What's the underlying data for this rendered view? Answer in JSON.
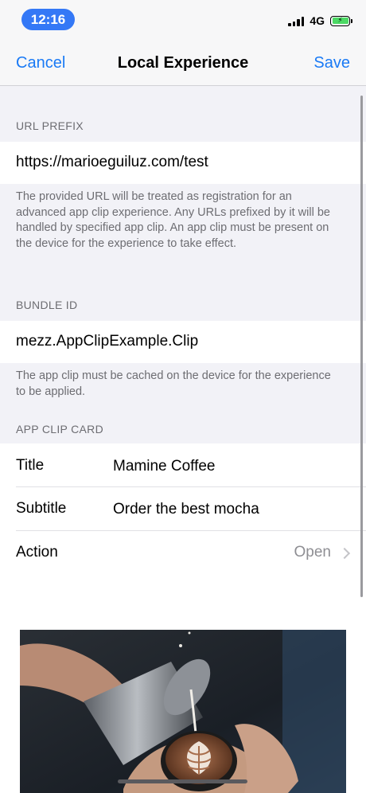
{
  "status_bar": {
    "time": "12:16",
    "network": "4G"
  },
  "nav": {
    "cancel_label": "Cancel",
    "title": "Local Experience",
    "save_label": "Save"
  },
  "url_section": {
    "header": "URL PREFIX",
    "value": "https://marioeguiluz.com/test",
    "footer": "The provided URL will be treated as registration for an advanced app clip experience. Any URLs prefixed by it will be handled by specified app clip. An app clip must be present on the device for the experience to take effect."
  },
  "bundle_section": {
    "header": "BUNDLE ID",
    "value": "mezz.AppClipExample.Clip",
    "footer": "The app clip must be cached on the device for the experience to be applied."
  },
  "card_section": {
    "header": "APP CLIP CARD",
    "rows": [
      {
        "label": "Title",
        "value": "Mamine Coffee"
      },
      {
        "label": "Subtitle",
        "value": "Order the best mocha"
      },
      {
        "label": "Action",
        "value": "Open"
      }
    ]
  },
  "colors": {
    "accent": "#1a7af5",
    "time_pill": "#3478f6",
    "battery": "#4cd964",
    "grouped_background": "#f2f2f7"
  },
  "icons": {
    "chevron": "chevron-right-icon",
    "signal": "cellular-signal-icon",
    "battery": "battery-charging-icon"
  }
}
